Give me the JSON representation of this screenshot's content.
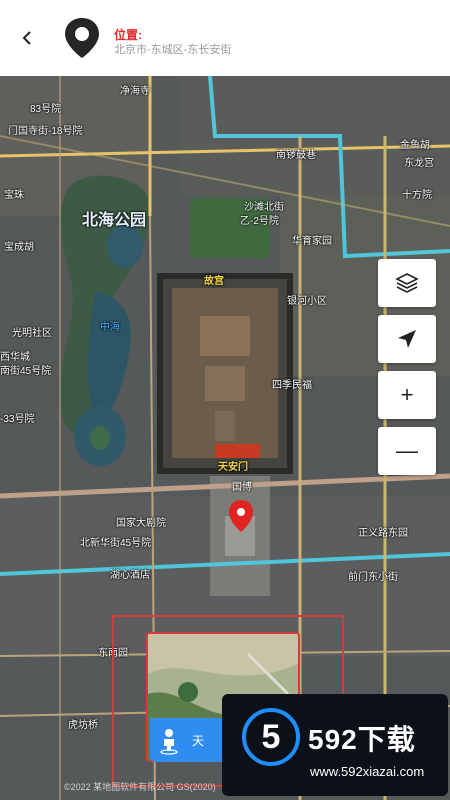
{
  "header": {
    "title": "位置:",
    "address": "北京市-东城区-东长安街"
  },
  "map": {
    "labels": {
      "jingshan": "净海寺",
      "no83": "83号院",
      "no18": "门国寺街-18号院",
      "beihai": "北海公园",
      "guangming": "光明社区",
      "zhonghai": "中海",
      "xihuacheng": "西华城",
      "no45a": "南街45号院",
      "no33": "-33号院",
      "beixinhua": "北新华街45号院",
      "guojiadajuyuan": "国家大剧院",
      "nanguoshi": "南锣鼓巷",
      "shatan": "沙滩北街",
      "no22": "乙-2号院",
      "huayu": "华育家园",
      "yinhu": "银河小区",
      "sijimin": "四季民福",
      "zhengyi": "正义路东园",
      "qianmen": "前门东小街",
      "dongjiaomin": "东南园",
      "hufangqiao": "虎坊桥",
      "huxin": "湖心酒店",
      "gugong": "故宫",
      "tiananmen": "天安门",
      "guobo": "国博",
      "baozhu": "宝珠",
      "baochenghu": "宝成胡",
      "jinhe": "金鱼胡",
      "donglong": "东龙宫",
      "shifangyuan": "十方院"
    },
    "copyright": "©2022 某地图软件有限公司 GS(2020)"
  },
  "controls": {
    "layers_icon": "layers-icon",
    "locate_icon": "navigation-arrow-icon",
    "zoom_in": "+",
    "zoom_out": "—"
  },
  "street_view": {
    "button_label": "天"
  },
  "watermark": {
    "brand": "592下载",
    "url": "www.592xiazai.com",
    "digit": "5"
  },
  "colors": {
    "accent_red": "#e12b2b",
    "street_view_blue": "#2f8cf0",
    "road_yellow": "#e6c56a",
    "road_cyan": "#4fc6d9"
  }
}
